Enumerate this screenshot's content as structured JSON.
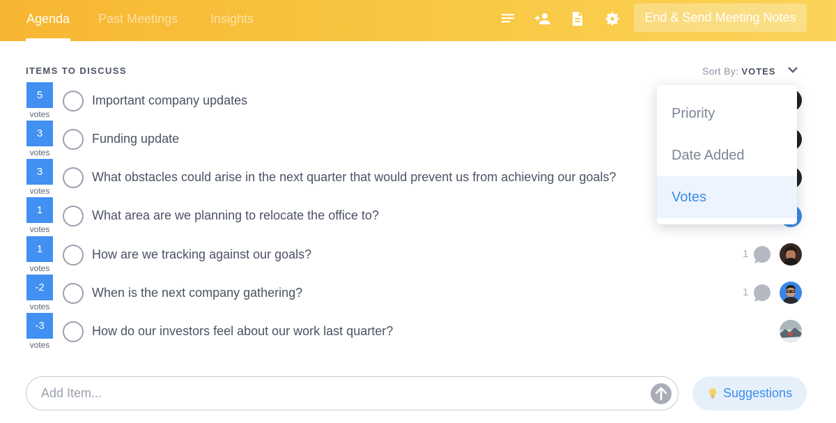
{
  "header": {
    "tabs": [
      {
        "label": "Agenda",
        "active": true
      },
      {
        "label": "Past Meetings",
        "active": false
      },
      {
        "label": "Insights",
        "active": false
      }
    ],
    "icons": [
      "list-icon",
      "add-user-icon",
      "document-icon",
      "gear-icon"
    ],
    "end_button_label": "End & Send Meeting Notes",
    "colors": {
      "gradient_start": "#f7b631",
      "gradient_end": "#fad35a"
    }
  },
  "agenda": {
    "section_title": "ITEMS TO DISCUSS",
    "sort_label": "Sort By:",
    "sort_value": "VOTES",
    "vote_unit": "votes",
    "items": [
      {
        "votes": "5",
        "text": "Important company updates",
        "comments": "",
        "avatar": "dark"
      },
      {
        "votes": "3",
        "text": "Funding update",
        "comments": "",
        "avatar": "dark"
      },
      {
        "votes": "3",
        "text": "What obstacles could arise in the next quarter that would prevent us from achieving our goals?",
        "comments": "",
        "avatar": "dark"
      },
      {
        "votes": "1",
        "text": "What area are we planning to relocate the office to?",
        "comments": "",
        "avatar": "blue"
      },
      {
        "votes": "1",
        "text": "How are we tracking against our goals?",
        "comments": "1",
        "avatar": "woman"
      },
      {
        "votes": "-2",
        "text": "When is the next company gathering?",
        "comments": "1",
        "avatar": "man-blue"
      },
      {
        "votes": "-3",
        "text": "How do our investors feel about our work last quarter?",
        "comments": "",
        "avatar": "landscape"
      }
    ]
  },
  "sort_dropdown": {
    "options": [
      "Priority",
      "Date Added",
      "Votes"
    ],
    "selected": "Votes"
  },
  "footer": {
    "input_placeholder": "Add Item...",
    "input_value": "",
    "suggestions_label": "Suggestions"
  },
  "colors": {
    "vote_blue": "#4190f2",
    "selected_blue": "#3c8ce9"
  }
}
